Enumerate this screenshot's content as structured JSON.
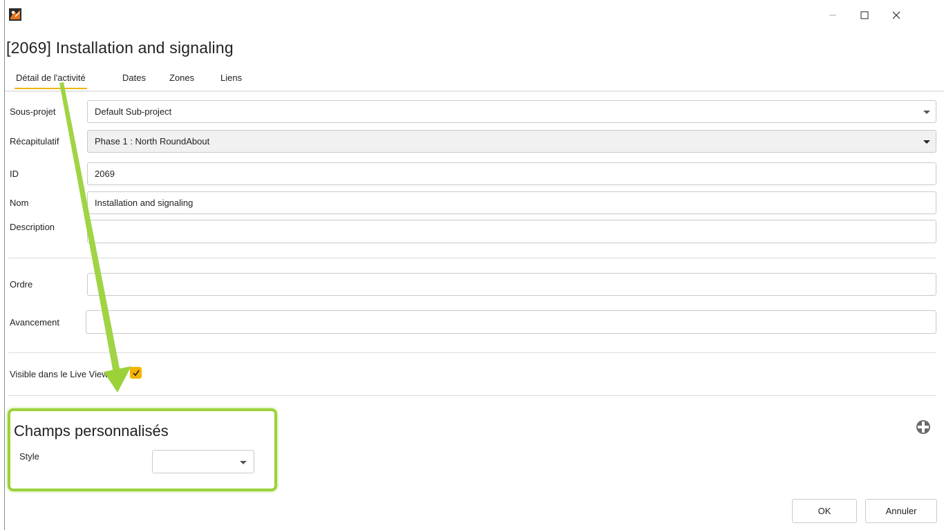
{
  "window": {
    "title": "[2069]  Installation and signaling",
    "controls": {
      "minimize": "—",
      "maximize": "☐",
      "close": "✕"
    }
  },
  "tabs": [
    {
      "label": "Détail de l'activité",
      "active": true
    },
    {
      "label": "Dates",
      "active": false
    },
    {
      "label": "Zones",
      "active": false
    },
    {
      "label": "Liens",
      "active": false
    }
  ],
  "form": {
    "sous_projet": {
      "label": "Sous-projet",
      "value": "Default Sub-project"
    },
    "recapitulatif": {
      "label": "Récapitulatif",
      "value": "Phase 1 : North RoundAbout"
    },
    "id": {
      "label": "ID",
      "value": "2069"
    },
    "nom": {
      "label": "Nom",
      "value": "Installation and signaling"
    },
    "description": {
      "label": "Description",
      "value": ""
    },
    "ordre": {
      "label": "Ordre",
      "value": ""
    },
    "avancement": {
      "label": "Avancement",
      "value": ""
    },
    "visible_live_view": {
      "label": "Visible dans le Live View",
      "checked": true
    }
  },
  "custom_fields": {
    "title": "Champs personnalisés",
    "style": {
      "label": "Style",
      "value": ""
    },
    "add_icon": "plus-icon"
  },
  "buttons": {
    "ok": "OK",
    "cancel": "Annuler"
  },
  "colors": {
    "accent": "#f0b400",
    "checkbox": "#f5b301",
    "annotation": "#9bd23a"
  }
}
